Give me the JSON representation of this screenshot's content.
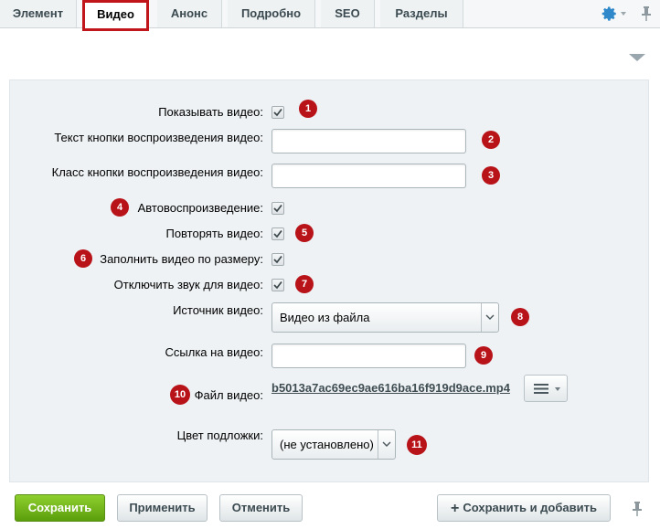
{
  "tabs": [
    {
      "label": "Элемент",
      "active": false
    },
    {
      "label": "Видео",
      "active": true
    },
    {
      "label": "Анонс",
      "active": false
    },
    {
      "label": "Подробно",
      "active": false
    },
    {
      "label": "SEO",
      "active": false
    },
    {
      "label": "Разделы",
      "active": false
    }
  ],
  "toolbar_icons": {
    "settings": "gear-icon",
    "pin": "pin-icon"
  },
  "form": {
    "show_video": {
      "label": "Показывать видео:",
      "checked": true,
      "badge": "1"
    },
    "play_button_text": {
      "label": "Текст кнопки воспроизведения видео:",
      "value": "",
      "badge": "2"
    },
    "play_button_class": {
      "label": "Класс кнопки воспроизведения видео:",
      "value": "",
      "badge": "3"
    },
    "autoplay": {
      "label": "Автовоспроизведение:",
      "checked": true,
      "badge": "4"
    },
    "loop": {
      "label": "Повторять видео:",
      "checked": true,
      "badge": "5"
    },
    "fit_video": {
      "label": "Заполнить видео по размеру:",
      "checked": true,
      "badge": "6"
    },
    "mute": {
      "label": "Отключить звук для видео:",
      "checked": true,
      "badge": "7"
    },
    "source": {
      "label": "Источник видео:",
      "selected": "Видео из файла",
      "badge": "8"
    },
    "video_link": {
      "label": "Ссылка на видео:",
      "value": "",
      "badge": "9"
    },
    "video_file": {
      "label": "Файл видео:",
      "filename": "b5013a7ac69ec9ae616ba16f919d9ace.mp4",
      "badge": "10"
    },
    "bg_color": {
      "label": "Цвет подложки:",
      "selected": "(не установлено)",
      "badge": "11"
    }
  },
  "buttons": {
    "save": "Сохранить",
    "apply": "Применить",
    "cancel": "Отменить",
    "save_and_add": "Сохранить и добавить"
  },
  "colors": {
    "accent_red": "#b9131a",
    "save_green": "#6fb31a",
    "tab_highlight": "#c0151b"
  }
}
